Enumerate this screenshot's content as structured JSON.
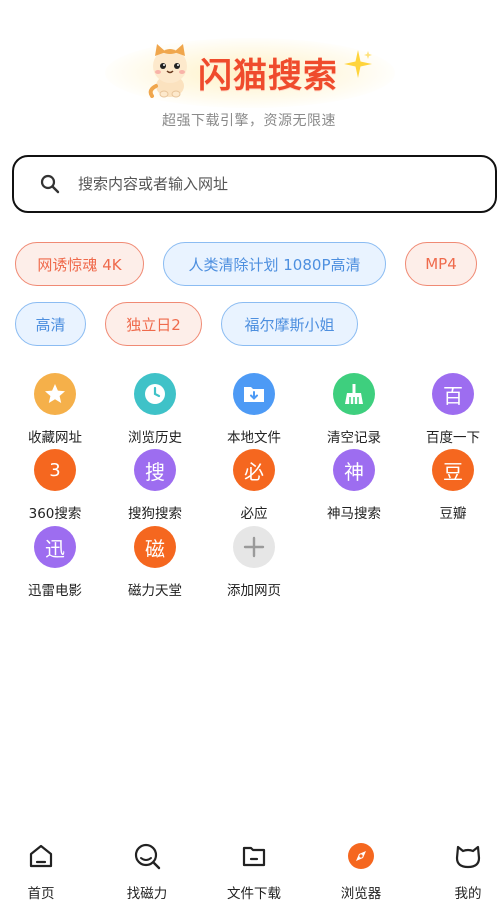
{
  "header": {
    "title": "闪猫搜索",
    "tagline": "超强下载引擎，资源无限速"
  },
  "search": {
    "placeholder": "搜索内容或者输入网址",
    "value": ""
  },
  "hot_tags": [
    {
      "label": "网诱惊魂 4K",
      "style": "red"
    },
    {
      "label": "人类清除计划 1080P高清",
      "style": "blue"
    },
    {
      "label": "MP4",
      "style": "red"
    },
    {
      "label": "高清",
      "style": "blue"
    },
    {
      "label": "独立日2",
      "style": "red"
    },
    {
      "label": "福尔摩斯小姐",
      "style": "blue"
    }
  ],
  "shortcuts": [
    {
      "label": "收藏网址",
      "glyph": "",
      "icon": "star-icon",
      "color": "#f5b04a"
    },
    {
      "label": "浏览历史",
      "glyph": "",
      "icon": "clock-icon",
      "color": "#3fc2c8"
    },
    {
      "label": "本地文件",
      "glyph": "",
      "icon": "folder-download-icon",
      "color": "#4d9af5"
    },
    {
      "label": "清空记录",
      "glyph": "",
      "icon": "broom-icon",
      "color": "#3ecf7e"
    },
    {
      "label": "百度一下",
      "glyph": "百",
      "icon": "baidu-icon",
      "color": "#9d6df0"
    },
    {
      "label": "360搜索",
      "glyph": "3",
      "icon": "360-icon",
      "color": "#f5671f"
    },
    {
      "label": "搜狗搜索",
      "glyph": "搜",
      "icon": "sogou-icon",
      "color": "#9d6df0"
    },
    {
      "label": "必应",
      "glyph": "必",
      "icon": "bing-icon",
      "color": "#f5671f"
    },
    {
      "label": "神马搜索",
      "glyph": "神",
      "icon": "shenma-icon",
      "color": "#9d6df0"
    },
    {
      "label": "豆瓣",
      "glyph": "豆",
      "icon": "douban-icon",
      "color": "#f5671f"
    },
    {
      "label": "迅雷电影",
      "glyph": "迅",
      "icon": "xunlei-icon",
      "color": "#9d6df0"
    },
    {
      "label": "磁力天堂",
      "glyph": "磁",
      "icon": "magnet-icon",
      "color": "#f5671f"
    },
    {
      "label": "添加网页",
      "glyph": "",
      "icon": "plus-icon",
      "color": "#e6e6e6"
    }
  ],
  "tabs": [
    {
      "label": "首页",
      "icon": "home-icon",
      "active": false
    },
    {
      "label": "找磁力",
      "icon": "search-magnet-icon",
      "active": false
    },
    {
      "label": "文件下载",
      "icon": "folder-icon",
      "active": false
    },
    {
      "label": "浏览器",
      "icon": "compass-icon",
      "active": true
    },
    {
      "label": "我的",
      "icon": "cat-face-icon",
      "active": false
    }
  ],
  "colors": {
    "accent": "#ef4b2c",
    "active_tab": "#f5671f"
  }
}
